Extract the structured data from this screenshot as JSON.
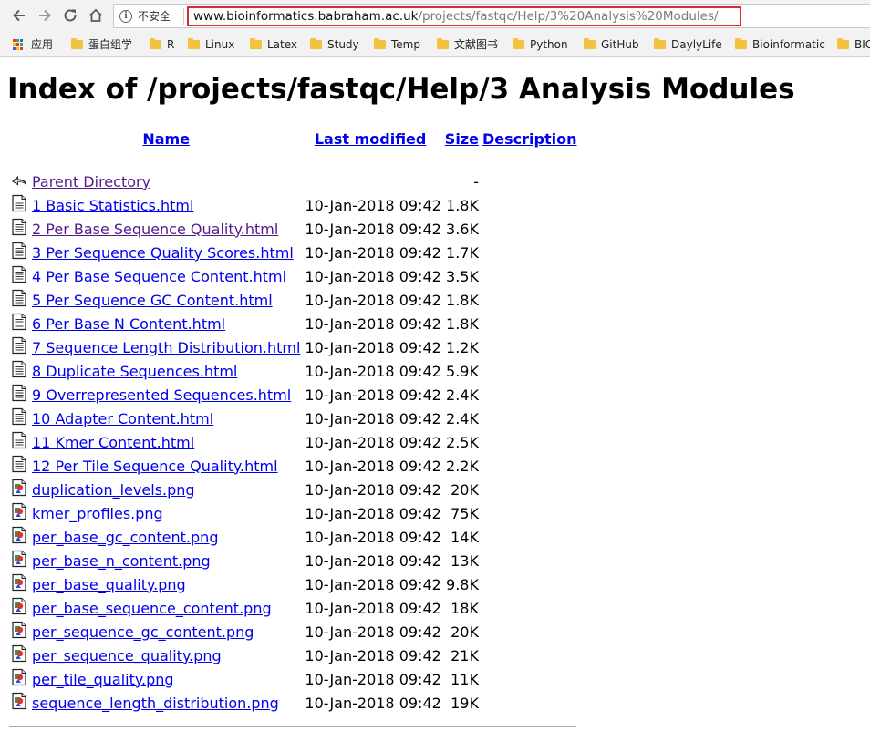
{
  "browser": {
    "security_label": "不安全",
    "url_host": "www.bioinformatics.babraham.ac.uk",
    "url_path": "/projects/fastqc/Help/3%20Analysis%20Modules/",
    "highlight_color": "#e0262d"
  },
  "bookmarks": {
    "apps_label": "应用",
    "items": [
      {
        "label": "蛋白组学"
      },
      {
        "label": "R"
      },
      {
        "label": "Linux"
      },
      {
        "label": "Latex"
      },
      {
        "label": "Study"
      },
      {
        "label": "Temp"
      },
      {
        "label": "文献图书"
      },
      {
        "label": "Python"
      },
      {
        "label": "GitHub"
      },
      {
        "label": "DaylyLife"
      },
      {
        "label": "Bioinformatic"
      },
      {
        "label": "BIG"
      }
    ]
  },
  "page": {
    "title": "Index of /projects/fastqc/Help/3 Analysis Modules",
    "columns": {
      "name": "Name",
      "last_modified": "Last modified",
      "size": "Size",
      "description": "Description"
    },
    "parent": {
      "label": "Parent Directory",
      "size": "-"
    },
    "files": [
      {
        "name": "1 Basic Statistics.html",
        "modified": "10-Jan-2018 09:42",
        "size": "1.8K",
        "type": "html-icon"
      },
      {
        "name": "2 Per Base Sequence Quality.html",
        "modified": "10-Jan-2018 09:42",
        "size": "3.6K",
        "type": "html-icon",
        "visited": true
      },
      {
        "name": "3 Per Sequence Quality Scores.html",
        "modified": "10-Jan-2018 09:42",
        "size": "1.7K",
        "type": "html-icon"
      },
      {
        "name": "4 Per Base Sequence Content.html",
        "modified": "10-Jan-2018 09:42",
        "size": "3.5K",
        "type": "html-icon"
      },
      {
        "name": "5 Per Sequence GC Content.html",
        "modified": "10-Jan-2018 09:42",
        "size": "1.8K",
        "type": "html-icon"
      },
      {
        "name": "6 Per Base N Content.html",
        "modified": "10-Jan-2018 09:42",
        "size": "1.8K",
        "type": "html-icon"
      },
      {
        "name": "7 Sequence Length Distribution.html",
        "modified": "10-Jan-2018 09:42",
        "size": "1.2K",
        "type": "html-icon"
      },
      {
        "name": "8 Duplicate Sequences.html",
        "modified": "10-Jan-2018 09:42",
        "size": "5.9K",
        "type": "html-icon"
      },
      {
        "name": "9 Overrepresented Sequences.html",
        "modified": "10-Jan-2018 09:42",
        "size": "2.4K",
        "type": "html-icon"
      },
      {
        "name": "10 Adapter Content.html",
        "modified": "10-Jan-2018 09:42",
        "size": "2.4K",
        "type": "html-icon"
      },
      {
        "name": "11 Kmer Content.html",
        "modified": "10-Jan-2018 09:42",
        "size": "2.5K",
        "type": "html-icon"
      },
      {
        "name": "12 Per Tile Sequence Quality.html",
        "modified": "10-Jan-2018 09:42",
        "size": "2.2K",
        "type": "html-icon"
      },
      {
        "name": "duplication_levels.png",
        "modified": "10-Jan-2018 09:42",
        "size": "20K",
        "type": "image-icon"
      },
      {
        "name": "kmer_profiles.png",
        "modified": "10-Jan-2018 09:42",
        "size": "75K",
        "type": "image-icon"
      },
      {
        "name": "per_base_gc_content.png",
        "modified": "10-Jan-2018 09:42",
        "size": "14K",
        "type": "image-icon"
      },
      {
        "name": "per_base_n_content.png",
        "modified": "10-Jan-2018 09:42",
        "size": "13K",
        "type": "image-icon"
      },
      {
        "name": "per_base_quality.png",
        "modified": "10-Jan-2018 09:42",
        "size": "9.8K",
        "type": "image-icon"
      },
      {
        "name": "per_base_sequence_content.png",
        "modified": "10-Jan-2018 09:42",
        "size": "18K",
        "type": "image-icon"
      },
      {
        "name": "per_sequence_gc_content.png",
        "modified": "10-Jan-2018 09:42",
        "size": "20K",
        "type": "image-icon"
      },
      {
        "name": "per_sequence_quality.png",
        "modified": "10-Jan-2018 09:42",
        "size": "21K",
        "type": "image-icon"
      },
      {
        "name": "per_tile_quality.png",
        "modified": "10-Jan-2018 09:42",
        "size": "11K",
        "type": "image-icon"
      },
      {
        "name": "sequence_length_distribution.png",
        "modified": "10-Jan-2018 09:42",
        "size": "19K",
        "type": "image-icon"
      }
    ]
  }
}
